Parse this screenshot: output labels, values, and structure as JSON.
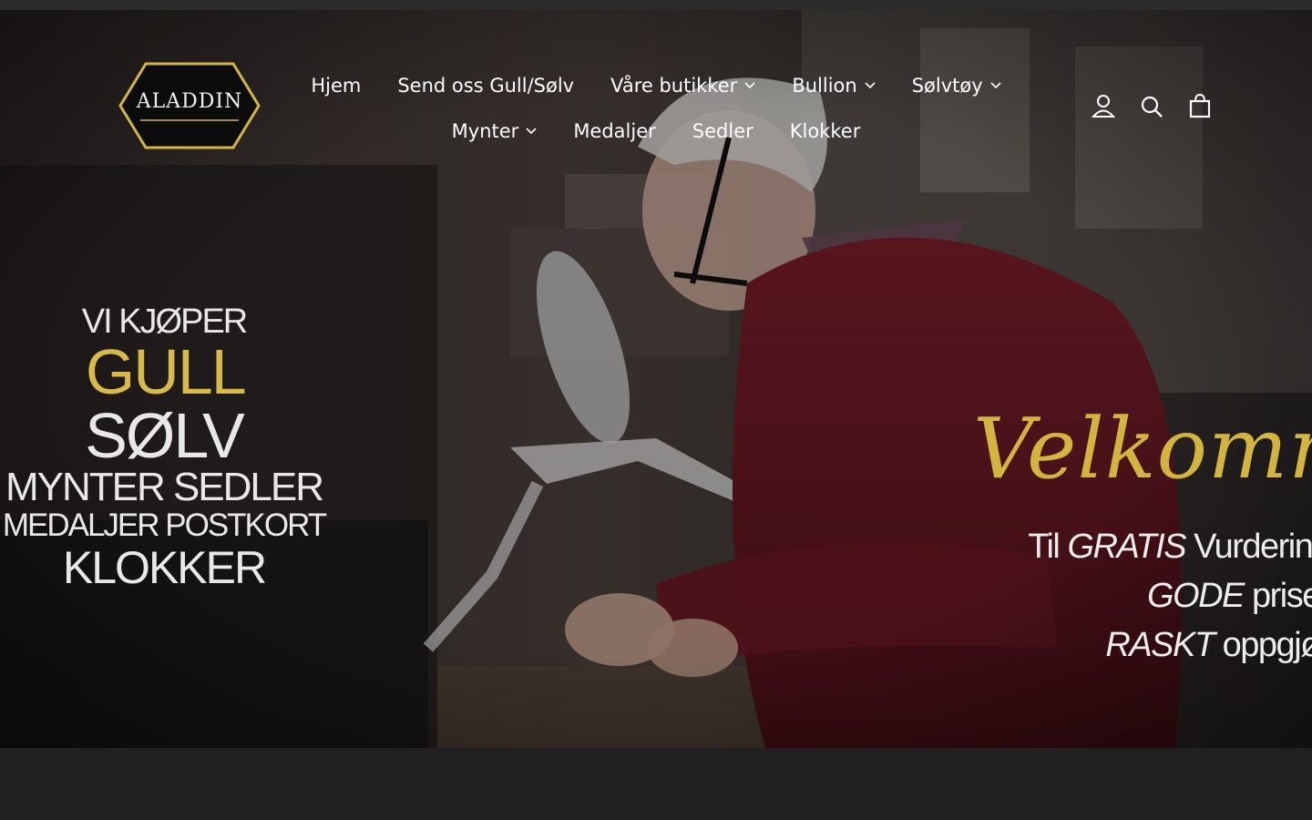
{
  "brand": {
    "name": "ALADDIN",
    "colors": {
      "gold": "#d9b948",
      "dark": "#212121"
    }
  },
  "nav": {
    "row1": [
      {
        "label": "Hjem",
        "dropdown": false
      },
      {
        "label": "Send oss Gull/Sølv",
        "dropdown": false
      },
      {
        "label": "Våre butikker",
        "dropdown": true
      },
      {
        "label": "Bullion",
        "dropdown": true
      },
      {
        "label": "Sølvtøy",
        "dropdown": true
      }
    ],
    "row2": [
      {
        "label": "Mynter",
        "dropdown": true
      },
      {
        "label": "Medaljer",
        "dropdown": false
      },
      {
        "label": "Sedler",
        "dropdown": false
      },
      {
        "label": "Klokker",
        "dropdown": false
      }
    ]
  },
  "header_icons": {
    "account": "user-icon",
    "search": "search-icon",
    "cart": "cart-icon"
  },
  "hero": {
    "left": {
      "line1": "VI KJØPER",
      "line2_gold": "GULL",
      "line2_white": "SØLV",
      "line3": "MYNTER SEDLER",
      "line4": "MEDALJER POSTKORT",
      "line5": "KLOKKER"
    },
    "right": {
      "welcome": "Velkommen",
      "line1_pre": "Til",
      "line1_em": "GRATIS",
      "line1_post": "Vurdering",
      "line2_em": "GODE",
      "line2_post": "priser",
      "line3_em": "RASKT",
      "line3_post": "oppgjør"
    }
  }
}
